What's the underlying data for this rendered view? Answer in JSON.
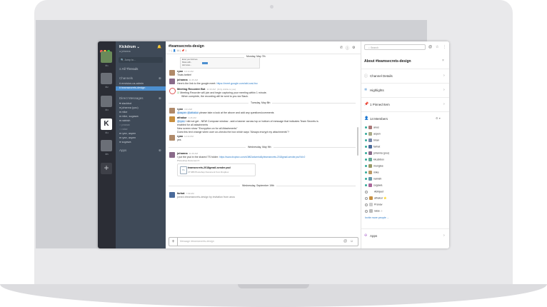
{
  "app": {
    "team_name": "Kickdrum",
    "team_caret": "⌄",
    "user_status": "johanna",
    "jump_placeholder": "Jump to...",
    "all_threads": "All Threads",
    "channels_label": "Channels",
    "channels": [
      "envision-us-admin",
      "teamsecrets-design"
    ],
    "dm_label": "Direct Messages",
    "dms": [
      "slackbot",
      "johanna (you)",
      "mike",
      "mike, sugawa",
      "nainish",
      "pranav",
      "raise",
      "ryan, aspen",
      "ryan, aspen",
      "sugawa"
    ],
    "apps_label": "Apps"
  },
  "teams": {
    "labels": [
      "⌘1",
      "⌘2",
      "⌘3",
      "⌘4",
      "⌘5"
    ],
    "k_letter": "K",
    "add": "+"
  },
  "channel": {
    "title": "#teamsecrets-design",
    "meta": "☆ | 👤 14 | 📌 1",
    "phone_icon": "✆",
    "info_icon": "ⓘ",
    "gear_icon": "⚙"
  },
  "thumbnail": {
    "line1": "Enter your link here",
    "line2": "Share with...",
    "line3": "Add notes..."
  },
  "messages": {
    "day1": "Monday, May 7th",
    "m1_who": "ryan",
    "m1_time": "10:14 AM",
    "m1_text": "Thats better!",
    "m2_who": "johanna",
    "m2_time": "11:25 AM",
    "m2_text": "Here's the link to the google meet: ",
    "m2_link": "https://meet.google.com/abi-xzsi-fsx",
    "m3_who": "Meeting Recorder Bot",
    "m3_time": "11:33 AM",
    "m3_meta": "(Only visible to you)",
    "m3_text1": "Meeting Recorder will join and begin capturing your meeting within 1 minute.",
    "m3_text2": "When complete, the recording will be sent to you via Slack.",
    "day2": "Tuesday, May 8th",
    "m4_who": "ryan",
    "m4_time": "4:21 AM",
    "m4_m1": "@aspen",
    "m4_m2": "@athakur",
    "m4_text": " please take a look at the above and add any questions/comments",
    "m5_who": "athakur",
    "m5_time": "4:26 AM",
    "m5_m1": "@ryan",
    "m5_text1": " I did not get - NEW Compose window - add a banner across top or bottom of message that indicates Team Secrets is",
    "m5_text2": "enabled for all attachments",
    "m5_text3": "New screen show \"Encryption on for all Attachments\"",
    "m5_text4": "Does this text change when user un-checks the box which says \"Always encrypt my attachments\"?",
    "m6_who": "ryan",
    "m6_time": "12:44 PM",
    "m6_text": "yes",
    "day3": "Wednesday, May 9th",
    "m7_who": "johanna",
    "m7_time": "11:29 AM",
    "m7_text": "I put the psd in the shared TS folder: ",
    "m7_link": "https://www.dropbox.com/s/3lf62wdwmtu6ly/teamsecrets-2018gmail-sender.psd?dl=0",
    "m7_preview": "Photoshop Document ▾",
    "file_name": "teamsecrets-2018gmail-sender.psd",
    "file_sub": "47 MB Photoshop Document from Dropbox",
    "file_ic": "Ps",
    "day4": "Wednesday, September 19th",
    "m8_who": "farhat",
    "m8_time": "7:09 AM",
    "m8_text": "joined #teamsecrets-design by invitation from anus"
  },
  "composer": {
    "placeholder": "Message #teamsecrets-design",
    "plus": "+",
    "emoji_icon": "☺",
    "at_icon": "@"
  },
  "right": {
    "search_placeholder": "Search",
    "at_icon": "@",
    "star_icon": "☆",
    "more_icon": "⋮",
    "title": "About #teamsecrets-design",
    "close": "×",
    "rows": [
      {
        "icon": "ⓘ",
        "label": "Channel Details"
      },
      {
        "icon": "✲",
        "label": "Highlights"
      },
      {
        "icon": "📌",
        "label": "1 Pinned Item"
      }
    ],
    "members_icon": "👤",
    "members_label": "14 Members",
    "members_extra": "⚙ ▾",
    "members": [
      "anus",
      "aspen",
      "brian",
      "farhat",
      "johanna (you)",
      "kkuzkbox",
      "munglee",
      "mike",
      "nainish",
      "sugawa",
      "Abhijeet",
      "athakur ⭐",
      "Pranav",
      "raise ☆"
    ],
    "invite": "Invite more people ...",
    "apps_label": "Apps",
    "apps_icon": "✣",
    "arrow": "›",
    "caret": "⌄",
    "accent": "#4c8fcf"
  }
}
